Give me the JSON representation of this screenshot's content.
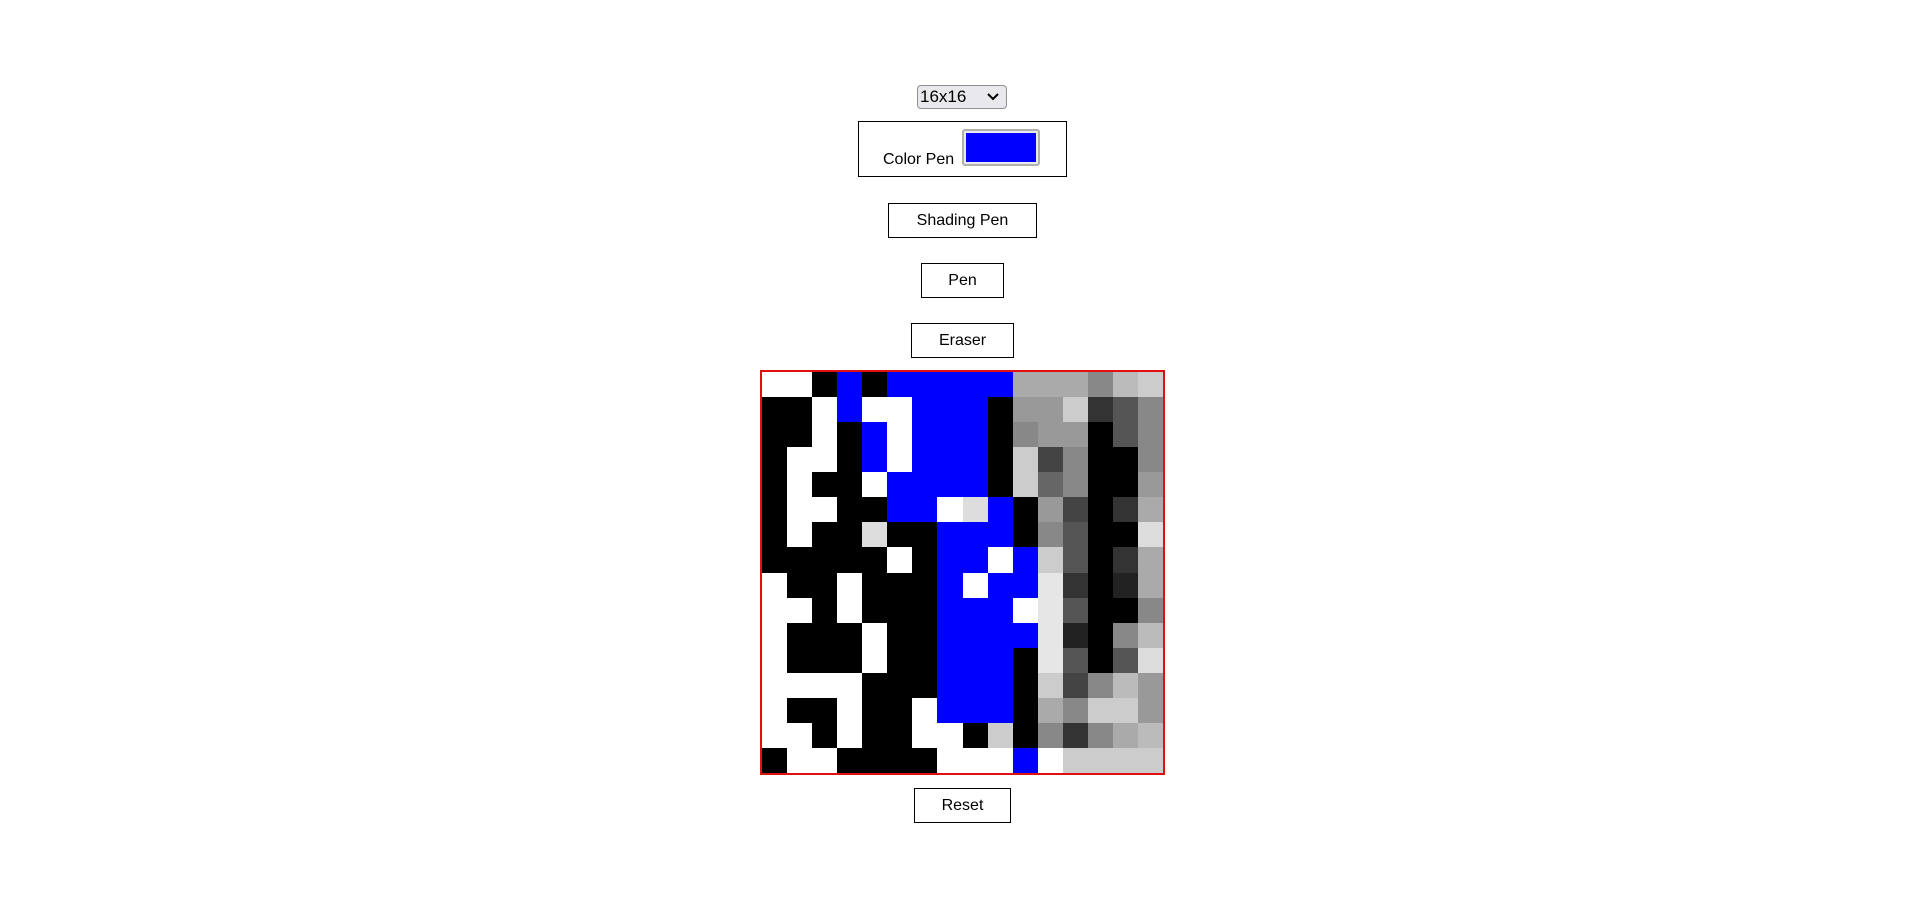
{
  "size_select": {
    "value": "16x16",
    "icon": "chevron-down-icon"
  },
  "color_pen": {
    "label": "Color Pen",
    "color": "#0000ff"
  },
  "buttons": {
    "shading": "Shading Pen",
    "pen": "Pen",
    "eraser": "Eraser",
    "reset": "Reset"
  },
  "grid": {
    "size": 16,
    "border_color": "#e01010",
    "palette": {
      "W": "#ffffff",
      "K": "#000000",
      "B": "#0000ff",
      "a": "#222222",
      "b": "#333333",
      "c": "#444444",
      "d": "#555555",
      "e": "#666666",
      "f": "#777777",
      "g": "#888888",
      "h": "#999999",
      "i": "#aaaaaa",
      "j": "#bbbbbb",
      "k": "#cccccc",
      "l": "#dddddd",
      "m": "#e6e6e6"
    },
    "rows": [
      "WWKBKBBBBBiiigjk",
      "KKWBWWBBBKhhkbdg",
      "KKWKBWBBBKghhKdg",
      "KWWKBWBBBKkcgKKg",
      "KWKKWBBBBKkegKKh",
      "KWWKKBBWlBKhcKbi",
      "KWKKlKKBBBKgdKKl",
      "KKKKKWKBBWBkdKbi",
      "WKKWKKKBWBBmbKai",
      "WWKWKKKBBBWmdKKg",
      "WKKKWKKBBBBmaKgj",
      "WKKKWKKBBBKmdKdl",
      "WWWWKKKBBBKkcgjh",
      "WKKWKKWBBBKigkkh",
      "WWKWKKWWKkKgbgij",
      "KWWKKKKWWWBWkkkk"
    ]
  }
}
